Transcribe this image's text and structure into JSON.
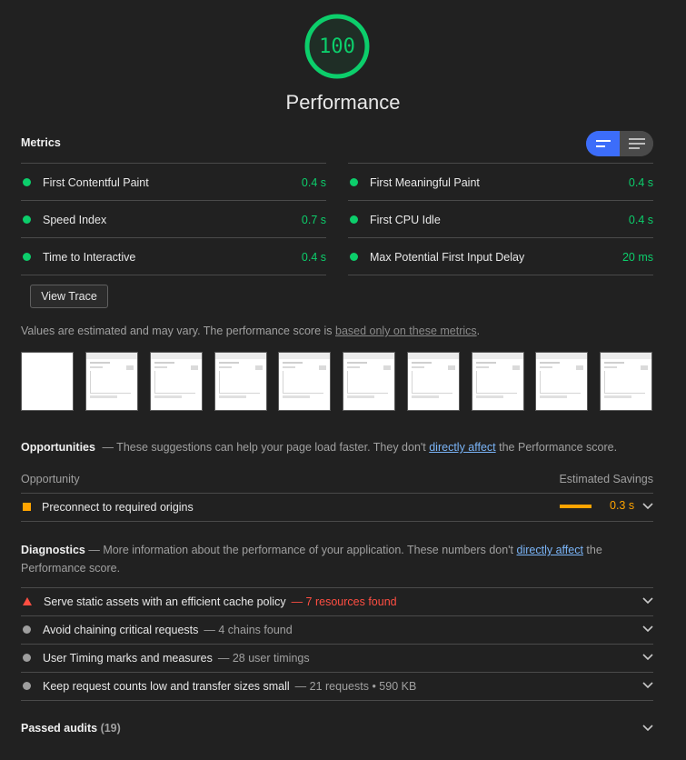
{
  "colors": {
    "pass": "#0cce6b",
    "average": "#ffa400",
    "fail": "#ff4e42",
    "accent": "#3c6dfa"
  },
  "score": {
    "value": "100",
    "title": "Performance"
  },
  "metrics": {
    "title": "Metrics",
    "items": [
      {
        "label": "First Contentful Paint",
        "value": "0.4 s"
      },
      {
        "label": "First Meaningful Paint",
        "value": "0.4 s"
      },
      {
        "label": "Speed Index",
        "value": "0.7 s"
      },
      {
        "label": "First CPU Idle",
        "value": "0.4 s"
      },
      {
        "label": "Time to Interactive",
        "value": "0.4 s"
      },
      {
        "label": "Max Potential First Input Delay",
        "value": "20 ms"
      }
    ],
    "toggle_icons": [
      "compact-view-icon",
      "expanded-view-icon"
    ],
    "view_trace": "View Trace",
    "disclaimer_text": "Values are estimated and may vary. The performance score is ",
    "disclaimer_link": "based only on these metrics",
    "disclaimer_end": "."
  },
  "filmstrip": {
    "frame_count": 10
  },
  "opportunities": {
    "title": "Opportunities",
    "desc": "— These suggestions can help your page load faster. They don't ",
    "link": "directly affect",
    "desc_end": " the Performance score.",
    "col_left": "Opportunity",
    "col_right": "Estimated Savings",
    "items": [
      {
        "label": "Preconnect to required origins",
        "value": "0.3 s"
      }
    ]
  },
  "diagnostics": {
    "title": "Diagnostics",
    "desc": "— More information about the performance of your application. These numbers don't ",
    "link": "directly affect",
    "desc_end": " the Performance score.",
    "items": [
      {
        "label": "Serve static assets with an efficient cache policy",
        "detail": "— 7 resources found",
        "status": "fail"
      },
      {
        "label": "Avoid chaining critical requests",
        "detail": "— 4 chains found",
        "status": "info"
      },
      {
        "label": "User Timing marks and measures",
        "detail": "— 28 user timings",
        "status": "info"
      },
      {
        "label": "Keep request counts low and transfer sizes small",
        "detail": "— 21 requests • 590 KB",
        "status": "info"
      }
    ]
  },
  "passed": {
    "label": "Passed audits",
    "count": "(19)"
  }
}
